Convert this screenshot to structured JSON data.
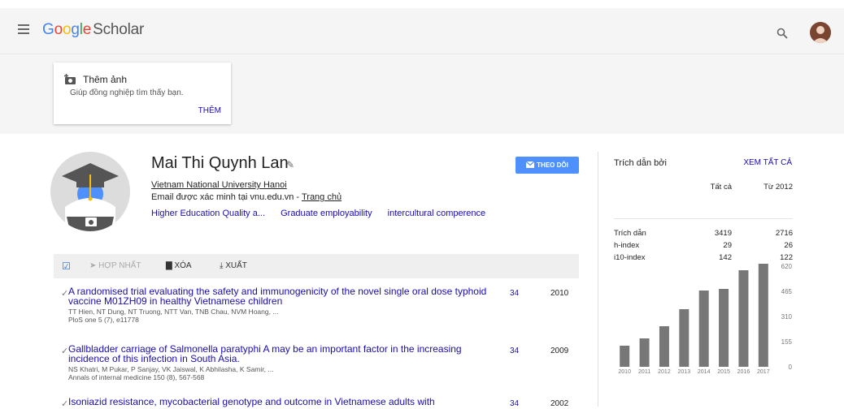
{
  "header": {
    "logo_google": [
      "G",
      "o",
      "o",
      "g",
      "l",
      "e"
    ],
    "logo_colors": [
      "#4285f4",
      "#ea4335",
      "#fbbc05",
      "#4285f4",
      "#34a853",
      "#ea4335"
    ],
    "logo_scholar": "Scholar"
  },
  "photo_card": {
    "title": "Thêm ảnh",
    "subtitle": "Giúp đồng nghiệp tìm thấy bạn.",
    "add_label": "THÊM"
  },
  "profile": {
    "name": "Mai Thi Quynh Lan",
    "affiliation": "Vietnam National University Hanoi",
    "email_text": "Email được xác minh tại vnu.edu.vn - ",
    "homepage_label": "Trang chủ",
    "interests": [
      "Higher Education Quality a...",
      "Graduate employability",
      "intercultural comperence"
    ],
    "follow_label": "THEO DÕI"
  },
  "toolbar": {
    "merge_label": "HỢP NHẤT",
    "delete_label": "XÓA",
    "export_label": "XUẤT"
  },
  "articles": [
    {
      "title": "A randomised trial evaluating the safety and immunogenicity of the novel single oral dose typhoid vaccine M01ZH09 in healthy Vietnamese children",
      "authors": "TT Hien, NT Dung, NT Truong, NTT Van, TNB Chau, NVM Hoang, ...",
      "source": "PloS one 5 (7), e11778",
      "cited": "34",
      "year": "2010"
    },
    {
      "title": "Gallbladder carriage of Salmonella paratyphi A may be an important factor in the increasing incidence of this infection in South Asia.",
      "authors": "NS Khatri, M Pukar, P Sanjay, VK Jaiswal, K Abhilasha, K Samir, ...",
      "source": "Annals of internal medicine 150 (8), 567-568",
      "cited": "34",
      "year": "2009"
    },
    {
      "title": "Isoniazid resistance, mycobacterial genotype and outcome in Vietnamese adults with",
      "authors": "",
      "source": "",
      "cited": "34",
      "year": "2002"
    }
  ],
  "cited_by": {
    "title": "Trích dẫn bởi",
    "view_all": "XEM TẤT CẢ",
    "col_all": "Tất cả",
    "col_since": "Từ 2012",
    "rows": [
      {
        "label": "Trích dẫn",
        "all": "3419",
        "since": "2716"
      },
      {
        "label": "h-index",
        "all": "29",
        "since": "26"
      },
      {
        "label": "i10-index",
        "all": "142",
        "since": "122"
      }
    ]
  },
  "chart_data": {
    "type": "bar",
    "categories": [
      "2010",
      "2011",
      "2012",
      "2013",
      "2014",
      "2015",
      "2016",
      "2017"
    ],
    "values": [
      130,
      175,
      250,
      355,
      470,
      480,
      595,
      635
    ],
    "yticks": [
      "620",
      "465",
      "310",
      "155",
      "0"
    ],
    "ylim": [
      0,
      620
    ],
    "bar_color": "#777777"
  }
}
